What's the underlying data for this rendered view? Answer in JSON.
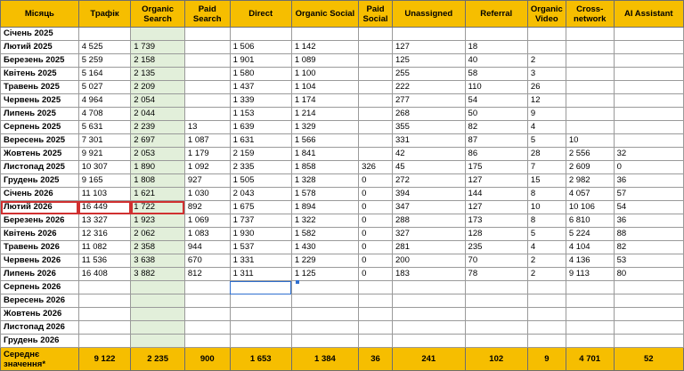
{
  "columns": [
    "Місяць",
    "Трафік",
    "Organic Search",
    "Paid Search",
    "Direct",
    "Organic Social",
    "Paid Social",
    "Unassigned",
    "Referral",
    "Organic Video",
    "Cross-network",
    "AI Assistant"
  ],
  "rows": [
    [
      "Січень 2025",
      "",
      "",
      "",
      "",
      "",
      "",
      "",
      "",
      "",
      "",
      ""
    ],
    [
      "Лютий 2025",
      "4 525",
      "1 739",
      "",
      "1 506",
      "1 142",
      "",
      "127",
      "18",
      "",
      "",
      ""
    ],
    [
      "Березень 2025",
      "5 259",
      "2 158",
      "",
      "1 901",
      "1 089",
      "",
      "125",
      "40",
      "2",
      "",
      ""
    ],
    [
      "Квітень 2025",
      "5 164",
      "2 135",
      "",
      "1 580",
      "1 100",
      "",
      "255",
      "58",
      "3",
      "",
      ""
    ],
    [
      "Травень 2025",
      "5 027",
      "2 209",
      "",
      "1 437",
      "1 104",
      "",
      "222",
      "110",
      "26",
      "",
      ""
    ],
    [
      "Червень 2025",
      "4 964",
      "2 054",
      "",
      "1 339",
      "1 174",
      "",
      "277",
      "54",
      "12",
      "",
      ""
    ],
    [
      "Липень 2025",
      "4 708",
      "2 044",
      "",
      "1 153",
      "1 214",
      "",
      "268",
      "50",
      "9",
      "",
      ""
    ],
    [
      "Серпень 2025",
      "5 631",
      "2 239",
      "13",
      "1 639",
      "1 329",
      "",
      "355",
      "82",
      "4",
      "",
      ""
    ],
    [
      "Вересень 2025",
      "7 301",
      "2 697",
      "1 087",
      "1 631",
      "1 566",
      "",
      "331",
      "87",
      "5",
      "10",
      ""
    ],
    [
      "Жовтень 2025",
      "9 921",
      "2 053",
      "1 179",
      "2 159",
      "1 841",
      "",
      "42",
      "86",
      "28",
      "2 556",
      "32"
    ],
    [
      "Листопад 2025",
      "10 307",
      "1 890",
      "1 092",
      "2 335",
      "1 858",
      "326",
      "45",
      "175",
      "7",
      "2 609",
      "0"
    ],
    [
      "Грудень 2025",
      "9 165",
      "1 808",
      "927",
      "1 505",
      "1 328",
      "0",
      "272",
      "127",
      "15",
      "2 982",
      "36"
    ],
    [
      "Січень 2026",
      "11 103",
      "1 621",
      "1 030",
      "2 043",
      "1 578",
      "0",
      "394",
      "144",
      "8",
      "4 057",
      "57"
    ],
    [
      "Лютий 2026",
      "16 449",
      "1 722",
      "892",
      "1 675",
      "1 894",
      "0",
      "347",
      "127",
      "10",
      "10 106",
      "54"
    ],
    [
      "Березень 2026",
      "13 327",
      "1 923",
      "1 069",
      "1 737",
      "1 322",
      "0",
      "288",
      "173",
      "8",
      "6 810",
      "36"
    ],
    [
      "Квітень 2026",
      "12 316",
      "2 062",
      "1 083",
      "1 930",
      "1 582",
      "0",
      "327",
      "128",
      "5",
      "5 224",
      "88"
    ],
    [
      "Травень 2026",
      "11 082",
      "2 358",
      "944",
      "1 537",
      "1 430",
      "0",
      "281",
      "235",
      "4",
      "4 104",
      "82"
    ],
    [
      "Червень 2026",
      "11 536",
      "3 638",
      "670",
      "1 331",
      "1 229",
      "0",
      "200",
      "70",
      "2",
      "4 136",
      "53"
    ],
    [
      "Липень 2026",
      "16 408",
      "3 882",
      "812",
      "1 311",
      "1 125",
      "0",
      "183",
      "78",
      "2",
      "9 113",
      "80"
    ],
    [
      "Серпень 2026",
      "",
      "",
      "",
      "",
      "",
      "",
      "",
      "",
      "",
      "",
      ""
    ],
    [
      "Вересень 2026",
      "",
      "",
      "",
      "",
      "",
      "",
      "",
      "",
      "",
      "",
      ""
    ],
    [
      "Жовтень 2026",
      "",
      "",
      "",
      "",
      "",
      "",
      "",
      "",
      "",
      "",
      ""
    ],
    [
      "Листопад 2026",
      "",
      "",
      "",
      "",
      "",
      "",
      "",
      "",
      "",
      "",
      ""
    ],
    [
      "Грудень 2026",
      "",
      "",
      "",
      "",
      "",
      "",
      "",
      "",
      "",
      "",
      ""
    ]
  ],
  "averages": [
    "Середнє значення*",
    "9 122",
    "2 235",
    "900",
    "1 653",
    "1 384",
    "36",
    "241",
    "102",
    "9",
    "4 701",
    "52"
  ],
  "colors": {
    "header_bg": "#f6be00",
    "organic_col_bg": "#e2efda",
    "highlight_border": "#d03030",
    "selection_border": "#2f6fcf"
  }
}
